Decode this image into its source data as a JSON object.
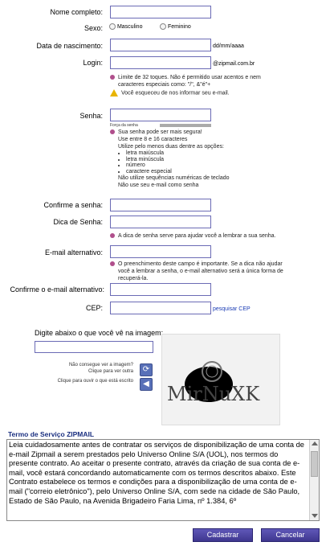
{
  "form": {
    "nome_label": "Nome completo:",
    "sexo_label": "Sexo:",
    "sexo_options": [
      "Masculino",
      "Feminino"
    ],
    "nascimento_label": "Data de nascimento:",
    "nascimento_hint": "dd/mm/aaaa",
    "login_label": "Login:",
    "login_domain": "@zipmail.com.br",
    "login_help_1": "Limite de 32 toques. Não é permitido usar acentos e nem",
    "login_help_2": "caracteres especiais como: \"/\", &\"é\"+",
    "login_warning": "Você esqueceu de nos informar seu e-mail.",
    "senha_label": "Senha:",
    "strength_label": "Força da senha",
    "senha_tip": "Sua senha pode ser mais segura!",
    "senha_rule_1": "Use entre 8 e 16 caracteres",
    "senha_rule_2": "Utilize pelo menos duas dentre as opções:",
    "senha_options": [
      "letra maiúscula",
      "letra minúscula",
      "número",
      "caractere especial"
    ],
    "senha_rule_3": "Não utilize sequências numéricas de teclado",
    "senha_rule_4": "Não use seu e-mail como senha",
    "confirma_label": "Confirme a senha:",
    "dica_label": "Dica de Senha:",
    "dica_help": "A dica de senha serve para ajudar você a lembrar a sua senha.",
    "email_alt_label": "E-mail alternativo:",
    "email_alt_help_1": "O preenchimento deste campo é importante. Se a dica não ajudar",
    "email_alt_help_2": "você a lembrar a senha, o e-mail alternativo será a única forma de",
    "email_alt_help_3": "recuperá-la.",
    "confirma_email_label": "Confirme o e-mail alternativo:",
    "cep_label": "CEP:",
    "cep_link": "pesquisar CEP"
  },
  "captcha": {
    "prompt": "Digite abaixo o que você vê na imagem:",
    "refresh_text_1": "Não consegue ver a imagem?",
    "refresh_text_2": "Clique para ver outra",
    "audio_text": "Clique para ouvir o que está escrito",
    "image_word": "MirNuXK"
  },
  "terms": {
    "title": "Termo de Serviço ZIPMAIL",
    "text": "Leia cuidadosamente antes de contratar os serviços de disponibilização de uma conta de e-mail Zipmail a serem prestados pelo Universo Online S/A (UOL), nos termos do presente contrato. Ao aceitar o presente contrato, através da criação de sua conta de e-mail, você estará concordando automaticamente com os termos descritos abaixo. Este Contrato estabelece os termos e condições para a disponibilização de uma conta de e-mail (\"correio eletrônico\"), pelo Universo Online S/A, com sede na cidade de São Paulo, Estado de São Paulo, na Avenida Brigadeiro Faria Lima, nº 1.384, 6º"
  },
  "buttons": {
    "submit": "Cadastrar",
    "cancel": "Cancelar"
  },
  "colors": {
    "input_border": "#6b6bb5",
    "bullet": "#b04f8c",
    "link": "#1a3cb5",
    "button": "#4a42a0"
  }
}
